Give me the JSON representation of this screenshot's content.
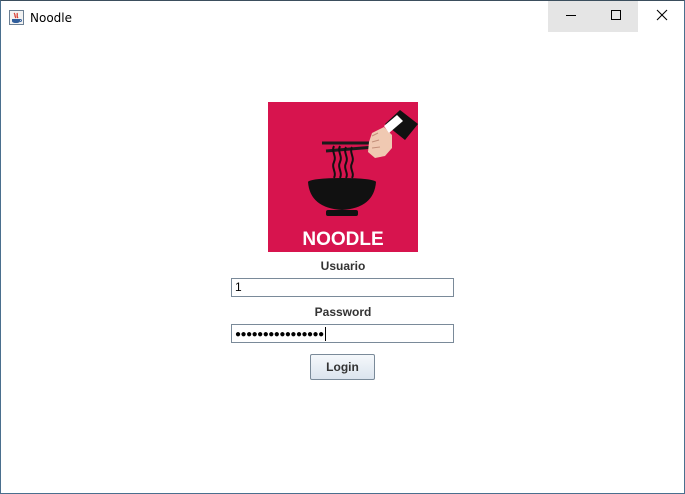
{
  "window": {
    "title": "Noodle",
    "minimize_icon": "minimize-icon",
    "maximize_icon": "maximize-icon",
    "close_icon": "close-icon"
  },
  "logo": {
    "text": "NOODLE",
    "background_color": "#d7144e"
  },
  "form": {
    "user_label": "Usuario",
    "user_value": "1",
    "password_label": "Password",
    "password_masked": "●●●●●●●●●●●●●●●●",
    "login_label": "Login"
  }
}
